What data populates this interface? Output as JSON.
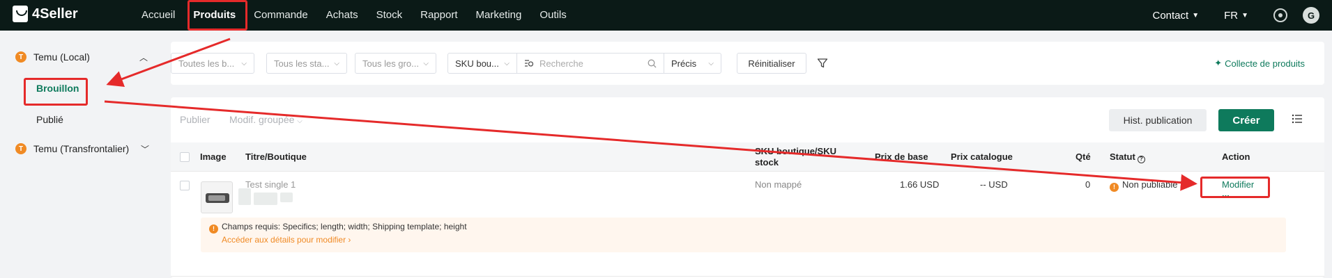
{
  "app": {
    "logo_text": "4Seller"
  },
  "nav": {
    "items": [
      "Accueil",
      "Produits",
      "Commande",
      "Achats",
      "Stock",
      "Rapport",
      "Marketing",
      "Outils"
    ],
    "contact": "Contact",
    "lang": "FR",
    "avatar_letter": "G"
  },
  "sidebar": {
    "groups": [
      {
        "badge": "T",
        "label": "Temu (Local)",
        "expanded": true,
        "items": [
          "Brouillon",
          "Publié"
        ]
      },
      {
        "badge": "T",
        "label": "Temu (Transfrontalier)",
        "expanded": false
      }
    ]
  },
  "filters": {
    "select1": "Toutes les b...",
    "select2": "Tous les sta...",
    "select3": "Tous les gro...",
    "sku_select": "SKU bou...",
    "search_placeholder": "Recherche",
    "match_select": "Précis",
    "reset": "Réinitialiser",
    "collect": "Collecte de produits"
  },
  "toolbar": {
    "publish": "Publier",
    "bulk_edit": "Modif. groupée",
    "history": "Hist. publication",
    "create": "Créer"
  },
  "table": {
    "headers": {
      "image": "Image",
      "title": "Titre/Boutique",
      "sku_line1": "SKU boutique/SKU",
      "sku_line2": "stock",
      "base_price": "Prix de base",
      "catalog_price": "Prix catalogue",
      "qty": "Qté",
      "status": "Statut",
      "action": "Action"
    },
    "rows": [
      {
        "title": "Test single 1",
        "sku": "Non mappé",
        "base_price": "1.66 USD",
        "catalog_price": "-- USD",
        "qty": "0",
        "status": "Non publiable",
        "action": "Modifier",
        "more": "...",
        "notice": "Champs requis: Specifics; length; width; Shipping template; height",
        "notice_link": "Accéder aux détails pour modifier"
      }
    ]
  },
  "colors": {
    "brand": "#0e7a5c",
    "topbar": "#0b1a17",
    "annotation": "#e52a2a",
    "warning": "#f08a24"
  }
}
